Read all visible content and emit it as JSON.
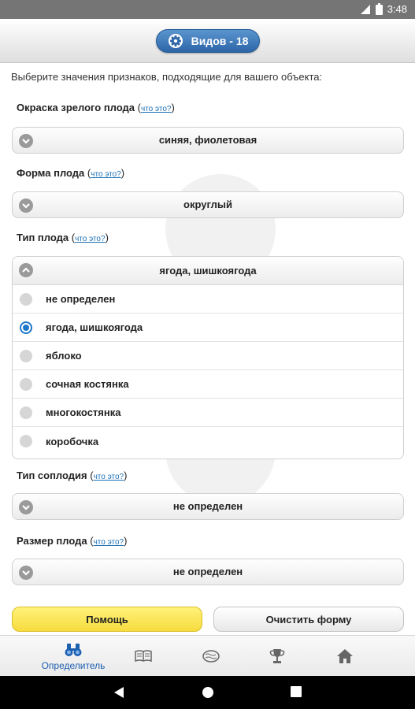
{
  "status": {
    "time": "3:48"
  },
  "header": {
    "species_button": "Видов - 18"
  },
  "intro": "Выберите значения признаков, подходящие для вашего объекта:",
  "help_link": "что это?",
  "fields": [
    {
      "label": "Окраска зрелого плода",
      "value": "синяя, фиолетовая"
    },
    {
      "label": "Форма плода",
      "value": "округлый"
    },
    {
      "label": "Тип плода",
      "value": "ягода, шишкоягода",
      "options": [
        "не определен",
        "ягода, шишкоягода",
        "яблоко",
        "сочная костянка",
        "многокостянка",
        "коробочка"
      ],
      "selected_index": 1
    },
    {
      "label": "Тип соплодия",
      "value": "не определен"
    },
    {
      "label": "Размер плода",
      "value": "не определен"
    }
  ],
  "buttons": {
    "help": "Помощь",
    "clear": "Очистить форму"
  },
  "tabs": [
    {
      "icon": "binoculars-icon",
      "label": "Определитель"
    },
    {
      "icon": "book-icon",
      "label": ""
    },
    {
      "icon": "brain-icon",
      "label": ""
    },
    {
      "icon": "trophy-icon",
      "label": ""
    },
    {
      "icon": "home-icon",
      "label": ""
    }
  ],
  "colors": {
    "accent": "#1d78c9",
    "help_button": "#f7dc3e",
    "header_button": "#3b76b8"
  }
}
